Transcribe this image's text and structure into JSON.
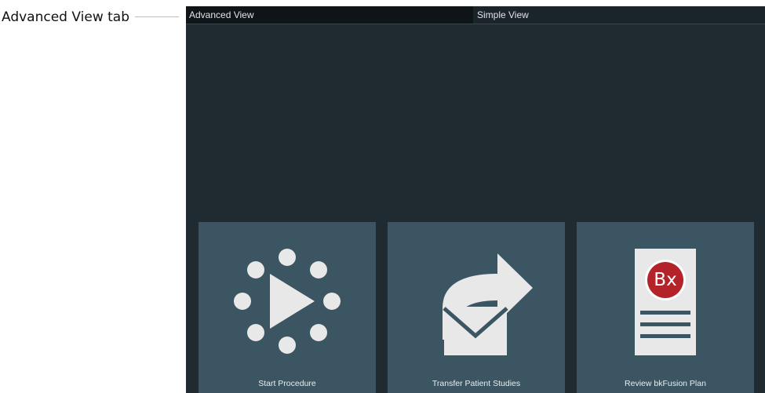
{
  "callout": {
    "text": "Advanced View tab"
  },
  "tabs": [
    {
      "label": "Advanced View",
      "active": true
    },
    {
      "label": "Simple View",
      "active": false
    }
  ],
  "tiles": [
    {
      "label": "Start Procedure",
      "icon": "start-procedure-icon"
    },
    {
      "label": "Transfer Patient Studies",
      "icon": "transfer-mail-icon"
    },
    {
      "label": "Review bkFusion Plan",
      "icon": "bx-document-icon",
      "badge": "Bx"
    }
  ],
  "colors": {
    "screen_bg": "#1f2b31",
    "tab_active_bg": "#0f1418",
    "tile_bg": "#3c5562",
    "icon_fill": "#e8e8e8",
    "badge_red": "#b5232a"
  }
}
